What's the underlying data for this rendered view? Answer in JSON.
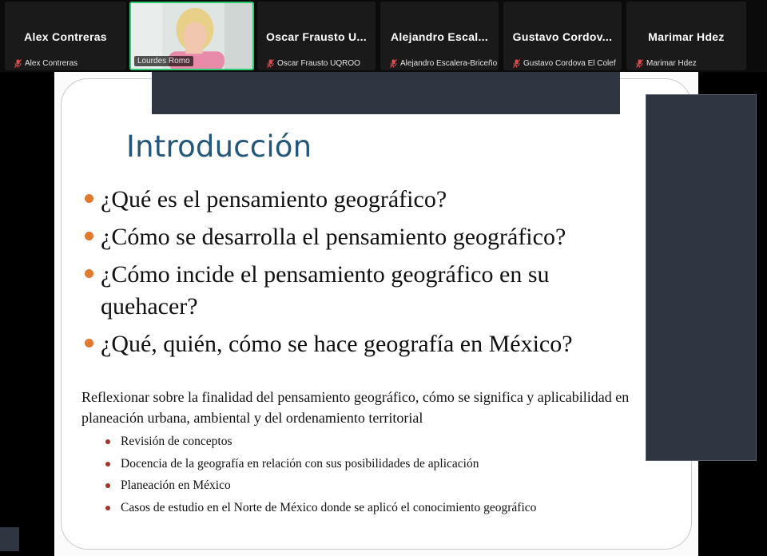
{
  "participants": [
    {
      "display_name": "Alex Contreras",
      "label": "Alex Contreras",
      "video": false
    },
    {
      "display_name": "",
      "label": "Lourdes Romo",
      "video": true
    },
    {
      "display_name": "Oscar Frausto U...",
      "label": "Oscar Frausto UQROO",
      "video": false
    },
    {
      "display_name": "Alejandro Escal...",
      "label": "Alejandro Escalera-Briceño",
      "video": false
    },
    {
      "display_name": "Gustavo Cordov...",
      "label": "Gustavo Cordova El Colef",
      "video": false
    },
    {
      "display_name": "Marimar Hdez",
      "label": "Marimar Hdez",
      "video": false
    }
  ],
  "slide": {
    "title": "Introducción",
    "questions": [
      "¿Qué es el pensamiento geográfico?",
      "¿Cómo se desarrolla el pensamiento geográfico?",
      "¿Cómo incide el pensamiento geográfico en su quehacer?",
      "¿Qué, quién, cómo se hace geografía en México?"
    ],
    "reflection": "Reflexionar sobre la  finalidad del pensamiento geográfico, cómo se significa y aplicabilidad en planeación urbana, ambiental y del ordenamiento territorial",
    "topics": [
      "Revisión de conceptos",
      "Docencia de la geografía  en relación con sus posibilidades de aplicación",
      "Planeación en México",
      "Casos de estudio en el Norte de México donde se aplicó el conocimiento geográfico"
    ]
  },
  "colors": {
    "active_speaker_border": "#2ecc71",
    "muted_icon": "#e5484d",
    "title_color": "#23577a",
    "question_bullet": "#e07a2e",
    "topic_bullet": "#a3342d",
    "overlay_panel": "#2f3541"
  },
  "icons": {
    "muted": "microphone-muted-icon"
  }
}
